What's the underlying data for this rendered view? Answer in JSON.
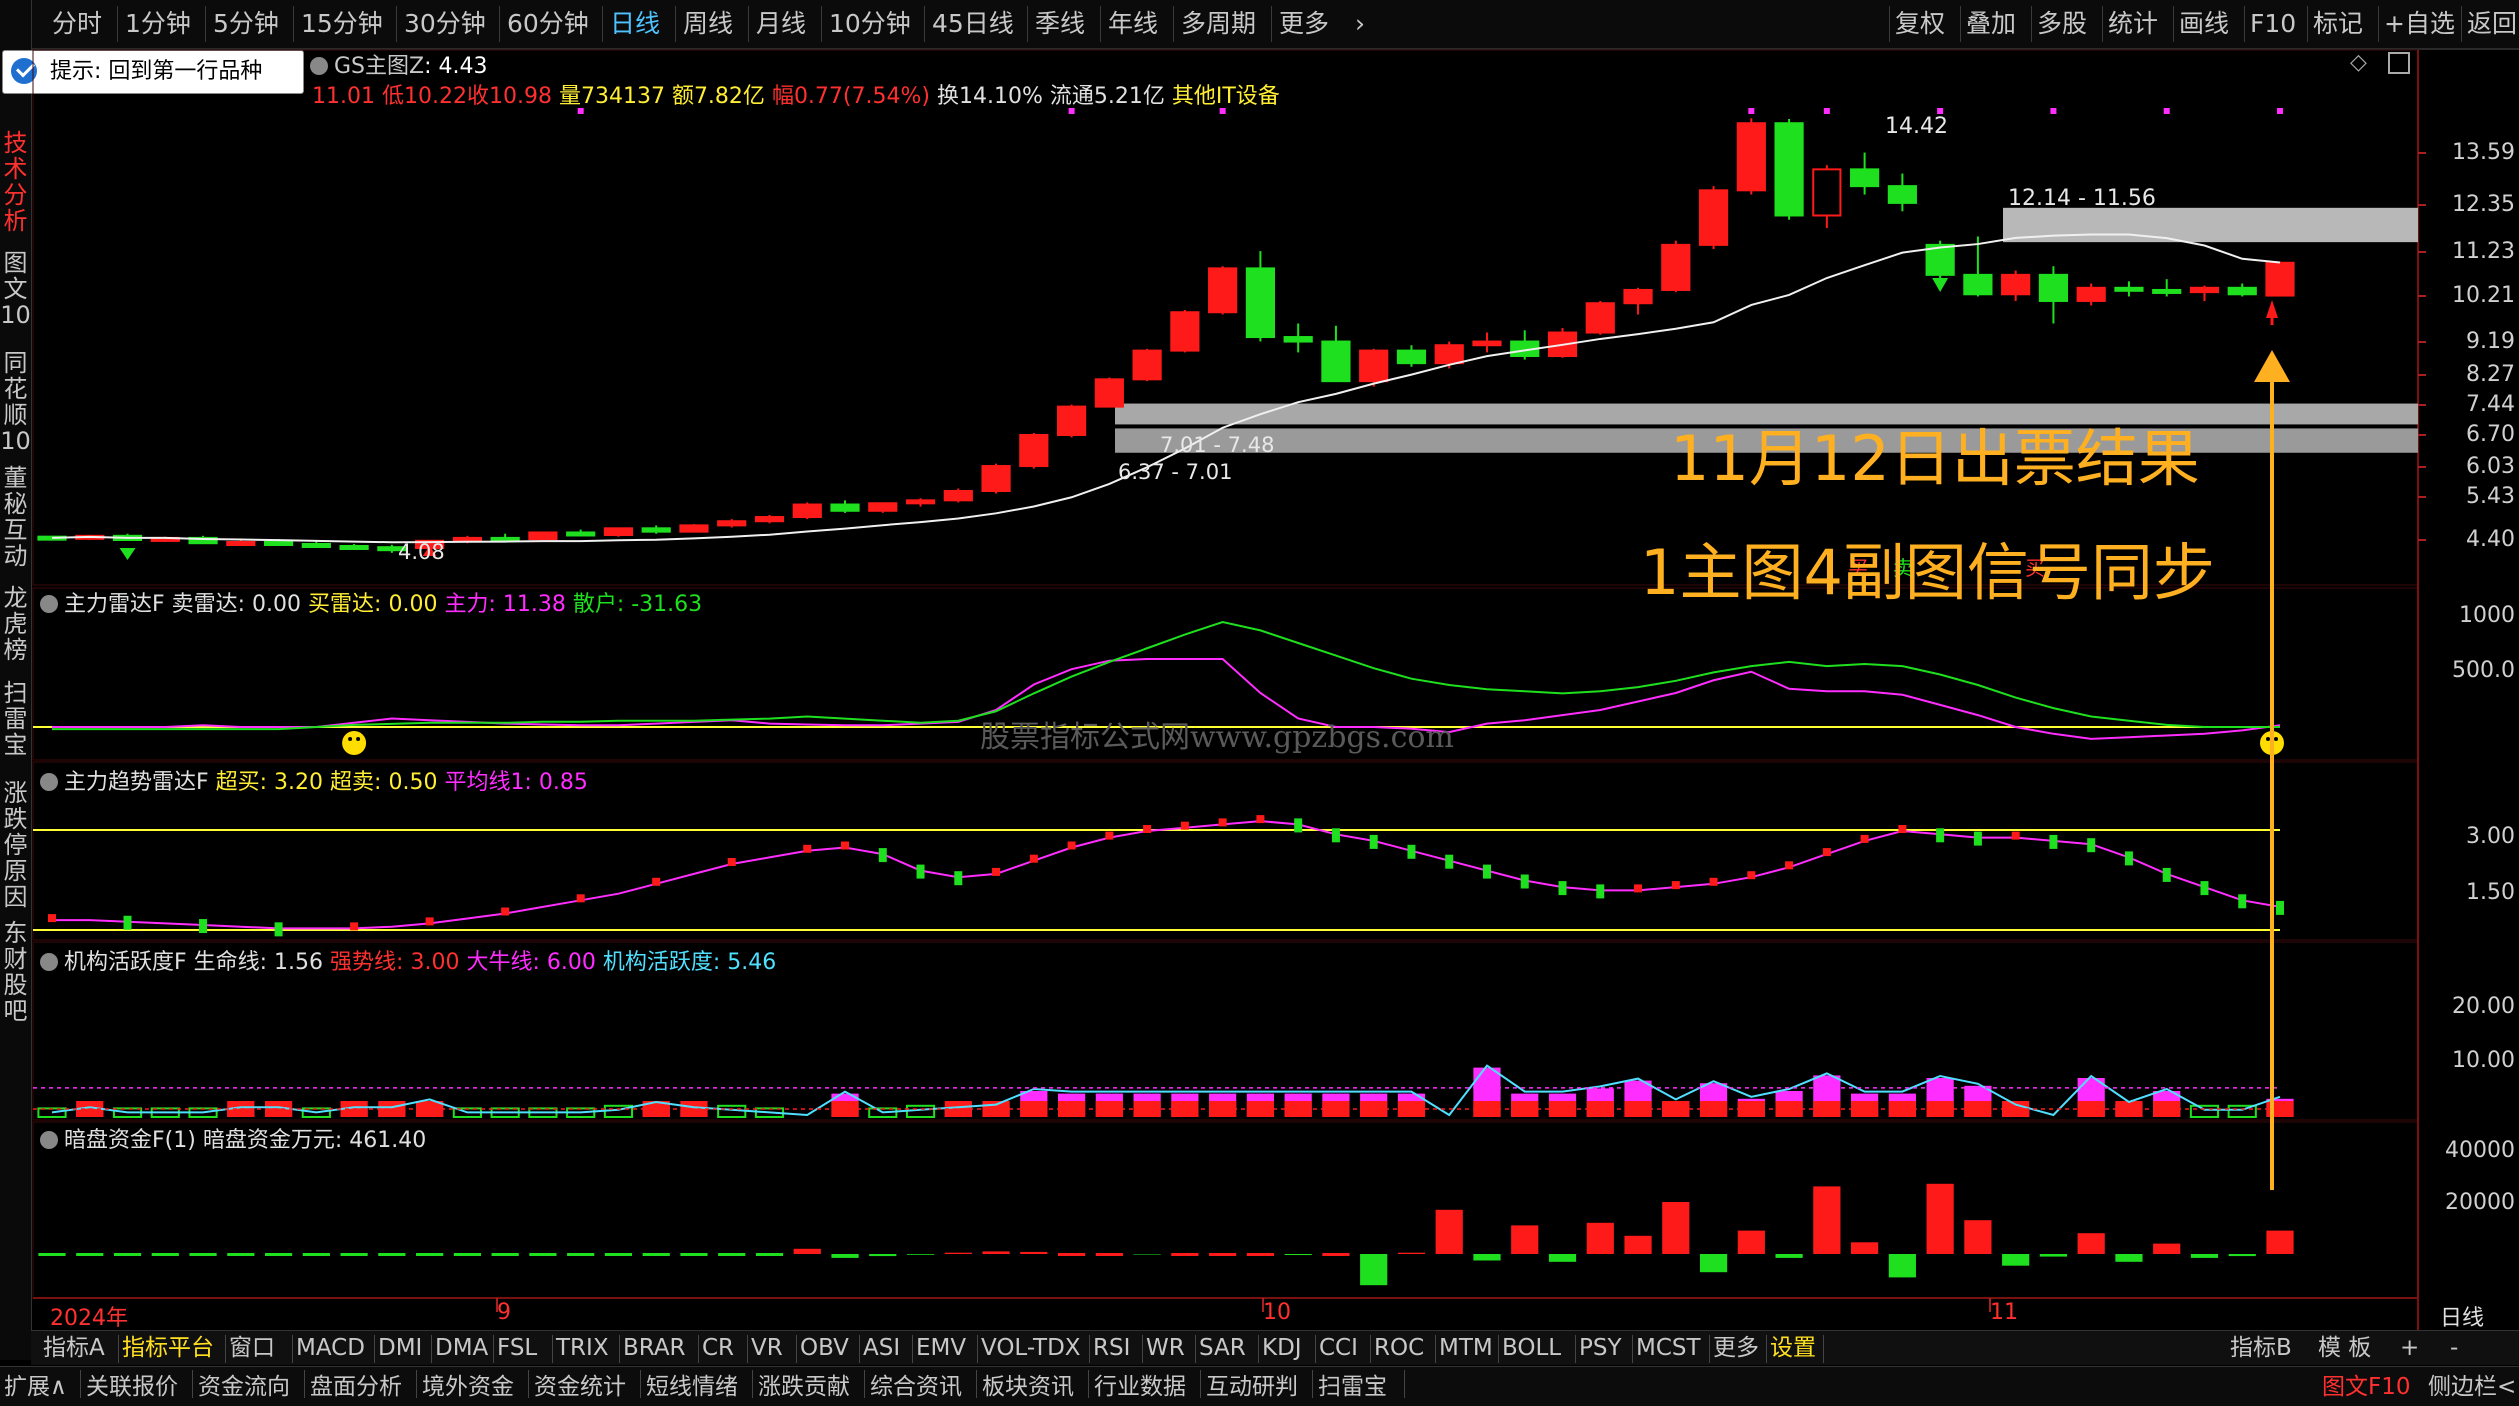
{
  "topbar": {
    "left_label": "分",
    "items": [
      "分时",
      "1分钟",
      "5分钟",
      "15分钟",
      "30分钟",
      "60分钟",
      "日线",
      "周线",
      "月线",
      "10分钟",
      "45日线",
      "季线",
      "年线",
      "多周期",
      "更多"
    ],
    "right_items": [
      "复权",
      "叠加",
      "多股",
      "统计",
      "画线",
      "F10",
      "标记",
      "+自选",
      "返回"
    ]
  },
  "left_tabs": [
    "技术分析",
    "图文10",
    "同花顺10",
    "董秘互动",
    "龙虎榜",
    "扫雷宝",
    "涨跌停原因",
    "东财股吧"
  ],
  "hint": {
    "label": "提示: 回到第一行品种"
  },
  "main_panel": {
    "indicator_name": "GS主图Z",
    "indicator_value": ": 4.43",
    "quote": {
      "high": "11.01",
      "low": "低10.22",
      "close": "收10.98",
      "volume": "量734137",
      "amount": "额7.82亿",
      "change": "幅0.77(7.54%)",
      "turnover": "换14.10%",
      "float": "流通5.21亿",
      "sector": "其他IT设备"
    },
    "price_labels": [
      "13.59",
      "12.35",
      "11.23",
      "10.21",
      "9.19",
      "8.27",
      "7.44",
      "6.70",
      "6.03",
      "5.43",
      "4.40"
    ],
    "annotations": {
      "peak": "14.42",
      "low_mark": "4.08",
      "zone_high": "12.14 - 11.56",
      "zone_mid": "7.01 - 7.48",
      "zone_low": "6.37 - 7.01"
    },
    "overlay_title": "11月12日出票结果",
    "overlay_subtitle": "1主图4副图信号同步",
    "small_tags": [
      "买",
      "卖",
      "买"
    ]
  },
  "panel1": {
    "name": "主力雷达F",
    "sell_label": "卖雷达: 0.00",
    "buy_label": "买雷达: 0.00",
    "main_label": "主力: 11.38",
    "retail_label": "散户: -31.63",
    "y_labels": [
      "1000",
      "500.0"
    ]
  },
  "watermark": "股票指标公式网www.gpzbgs.com",
  "panel2": {
    "name": "主力趋势雷达F",
    "overbuy_label": "超买: 3.20",
    "oversell_label": "超卖: 0.50",
    "avg_label": "平均线1: 0.85",
    "y_labels": [
      "3.00",
      "1.50"
    ]
  },
  "panel3": {
    "name": "机构活跃度F",
    "life_label": "生命线: 1.56",
    "strong_label": "强势线: 3.00",
    "bull_label": "大牛线: 6.00",
    "activity_label": "机构活跃度: 5.46",
    "y_labels": [
      "20.00",
      "10.00"
    ],
    "bars": [
      1,
      3,
      1,
      1,
      1,
      3,
      3,
      1,
      3,
      3,
      6,
      1,
      1,
      1,
      1,
      2,
      5,
      3,
      2,
      1,
      0,
      9,
      1,
      2,
      3,
      4,
      10,
      9,
      9,
      9,
      9,
      9,
      9,
      9,
      9,
      9,
      9,
      0,
      19,
      9,
      9,
      11,
      14,
      6,
      13,
      7,
      10,
      16,
      9,
      9,
      15,
      12,
      4,
      0,
      15,
      5,
      10,
      2,
      2,
      7
    ],
    "avg_line": 4
  },
  "panel4": {
    "name": "暗盘资金F(1)",
    "value_label": "暗盘资金万元: 461.40",
    "y_labels": [
      "40000",
      "20000"
    ],
    "bars": [
      0,
      0,
      0,
      0,
      0,
      0,
      0,
      0,
      0,
      0,
      0,
      0,
      0,
      0,
      0,
      0,
      0,
      0,
      0,
      0,
      2000,
      -1500,
      -800,
      -300,
      500,
      1000,
      800,
      0,
      0,
      -200,
      0,
      0,
      0,
      -400,
      0,
      -12000,
      500,
      17000,
      -2500,
      11000,
      -3000,
      12000,
      7000,
      20000,
      -7000,
      9000,
      -1500,
      26000,
      4500,
      -9000,
      27000,
      13000,
      -4500,
      -1000,
      8000,
      -3000,
      4000,
      -1500,
      -800,
      9000
    ],
    "y_max": 40000
  },
  "time_axis": {
    "labels": [
      "2024年",
      "9",
      "10",
      "11"
    ],
    "right_label": "日线"
  },
  "bottom_tabs": [
    "指标A",
    "指标平台",
    "窗口",
    "MACD",
    "DMI",
    "DMA",
    "FSL",
    "TRIX",
    "BRAR",
    "CR",
    "VR",
    "OBV",
    "ASI",
    "EMV",
    "VOL-TDX",
    "RSI",
    "WR",
    "SAR",
    "KDJ",
    "CCI",
    "ROC",
    "MTM",
    "BOLL",
    "PSY",
    "MCST",
    "更多",
    "设置"
  ],
  "bottom_right_tabs": [
    "指标B",
    "模 板",
    "+",
    "-"
  ],
  "footer_tabs": [
    "扩展∧",
    "关联报价",
    "资金流向",
    "盘面分析",
    "境外资金",
    "资金统计",
    "短线情绪",
    "涨跌贡献",
    "综合资讯",
    "板块资讯",
    "行业数据",
    "互动研判",
    "扫雷宝"
  ],
  "footer_right": [
    "图文F10",
    "侧边栏<"
  ],
  "colors": {
    "up": "#ff1a1a",
    "down": "#1ee01e",
    "accent": "#4fc3ff",
    "overlay": "#ffb020",
    "magenta": "#ff2dff",
    "yellow": "#ffff33"
  },
  "chart_data": {
    "type": "candlestick",
    "x_axis_labels": [
      "2024年",
      "9",
      "10",
      "11"
    ],
    "price_axis": [
      4.4,
      5.43,
      6.03,
      6.7,
      7.44,
      8.27,
      9.19,
      10.21,
      11.23,
      12.35,
      13.59
    ],
    "ohlc": [
      [
        4.48,
        4.5,
        4.42,
        4.45
      ],
      [
        4.45,
        4.52,
        4.4,
        4.5
      ],
      [
        4.5,
        4.55,
        4.38,
        4.4
      ],
      [
        4.4,
        4.48,
        4.35,
        4.45
      ],
      [
        4.45,
        4.5,
        4.3,
        4.32
      ],
      [
        4.32,
        4.4,
        4.25,
        4.35
      ],
      [
        4.35,
        4.42,
        4.28,
        4.3
      ],
      [
        4.3,
        4.38,
        4.22,
        4.25
      ],
      [
        4.25,
        4.3,
        4.18,
        4.22
      ],
      [
        4.22,
        4.28,
        4.08,
        4.2
      ],
      [
        4.2,
        4.4,
        4.15,
        4.38
      ],
      [
        4.38,
        4.5,
        4.32,
        4.45
      ],
      [
        4.45,
        4.55,
        4.38,
        4.42
      ],
      [
        4.42,
        4.6,
        4.4,
        4.58
      ],
      [
        4.58,
        4.65,
        4.5,
        4.52
      ],
      [
        4.52,
        4.7,
        4.48,
        4.68
      ],
      [
        4.68,
        4.75,
        4.55,
        4.6
      ],
      [
        4.6,
        4.78,
        4.58,
        4.75
      ],
      [
        4.75,
        4.9,
        4.7,
        4.85
      ],
      [
        4.85,
        5.0,
        4.8,
        4.95
      ],
      [
        4.95,
        5.3,
        4.9,
        5.25
      ],
      [
        5.25,
        5.35,
        5.05,
        5.1
      ],
      [
        5.1,
        5.3,
        5.05,
        5.28
      ],
      [
        5.28,
        5.4,
        5.2,
        5.35
      ],
      [
        5.35,
        5.6,
        5.3,
        5.55
      ],
      [
        5.55,
        6.1,
        5.5,
        6.05
      ],
      [
        6.05,
        6.75,
        6.0,
        6.7
      ],
      [
        6.7,
        7.45,
        6.65,
        7.4
      ],
      [
        7.4,
        8.2,
        7.38,
        8.15
      ],
      [
        8.15,
        9.0,
        8.1,
        8.95
      ],
      [
        8.95,
        9.9,
        8.9,
        9.85
      ],
      [
        9.85,
        10.9,
        9.8,
        10.85
      ],
      [
        10.85,
        11.25,
        9.2,
        9.3
      ],
      [
        9.3,
        9.6,
        8.9,
        9.2
      ],
      [
        9.2,
        9.55,
        8.1,
        8.1
      ],
      [
        8.1,
        9.0,
        7.95,
        8.95
      ],
      [
        8.95,
        9.1,
        8.5,
        8.6
      ],
      [
        8.6,
        9.2,
        8.45,
        9.1
      ],
      [
        9.1,
        9.4,
        8.9,
        9.2
      ],
      [
        9.2,
        9.45,
        8.7,
        8.8
      ],
      [
        8.8,
        9.5,
        8.75,
        9.4
      ],
      [
        9.4,
        10.1,
        9.35,
        10.05
      ],
      [
        10.05,
        10.4,
        9.8,
        10.35
      ],
      [
        10.35,
        11.5,
        10.3,
        11.4
      ],
      [
        11.4,
        12.8,
        11.3,
        12.7
      ],
      [
        12.7,
        14.42,
        12.6,
        14.3
      ],
      [
        14.3,
        14.4,
        12.0,
        12.1
      ],
      [
        12.1,
        13.3,
        11.8,
        13.2
      ],
      [
        13.2,
        13.6,
        12.6,
        12.8
      ],
      [
        12.8,
        13.1,
        12.2,
        12.4
      ],
      [
        11.4,
        11.5,
        10.6,
        10.7
      ],
      [
        10.7,
        11.6,
        10.2,
        10.25
      ],
      [
        10.25,
        10.8,
        10.1,
        10.7
      ],
      [
        10.7,
        10.9,
        9.6,
        10.1
      ],
      [
        10.1,
        10.5,
        10.0,
        10.4
      ],
      [
        10.4,
        10.55,
        10.2,
        10.35
      ],
      [
        10.35,
        10.6,
        10.2,
        10.3
      ],
      [
        10.3,
        10.45,
        10.1,
        10.4
      ],
      [
        10.4,
        10.5,
        10.2,
        10.25
      ],
      [
        10.22,
        11.01,
        10.22,
        10.98
      ]
    ]
  }
}
